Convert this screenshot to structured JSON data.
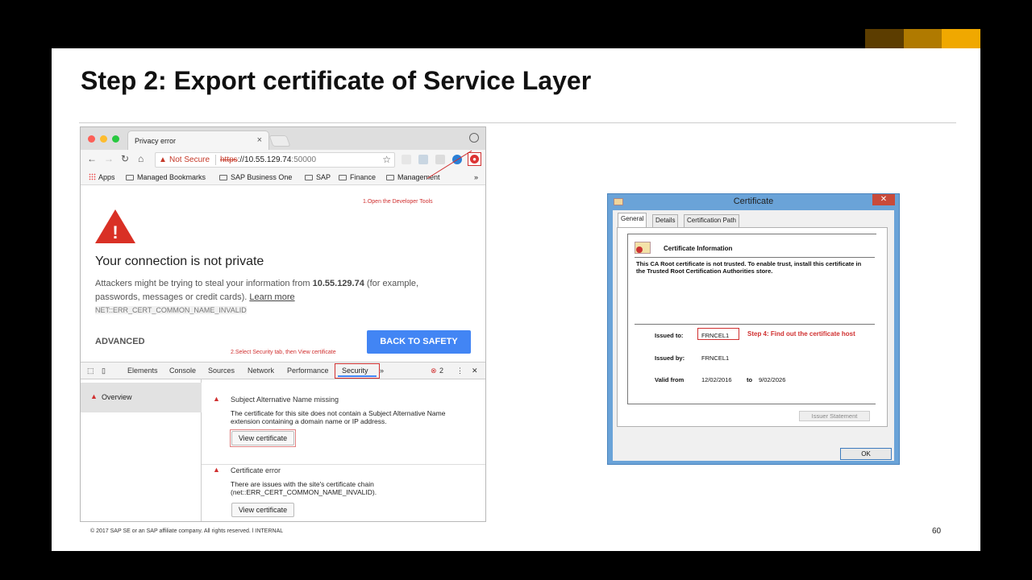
{
  "slide": {
    "title": "Step 2: Export certificate of Service Layer",
    "footer": "© 2017 SAP SE or an SAP affiliate company. All rights reserved.  ǀ   INTERNAL",
    "page_number": "60",
    "brand_colors": [
      "#5c3d00",
      "#b07a00",
      "#f0a800"
    ]
  },
  "browser": {
    "tab_title": "Privacy error",
    "tab_close": "×",
    "url_not_secure": "Not Secure",
    "url_scheme": "https",
    "url_rest": "://10.55.129.74",
    "url_port": ":50000",
    "bookmarks": [
      "Apps",
      "Managed Bookmarks",
      "SAP Business One",
      "SAP",
      "Finance",
      "Management"
    ],
    "bookmarks_more": "»",
    "annotation_1": "1.Open the Developer Tools",
    "error_heading": "Your connection is not private",
    "error_body_pre": "Attackers might be trying to steal your information from ",
    "error_host": "10.55.129.74",
    "error_body_post": " (for example, passwords, messages or credit cards). ",
    "learn_more": "Learn more",
    "error_code": "NET::ERR_CERT_COMMON_NAME_INVALID",
    "advanced": "ADVANCED",
    "back_to_safety": "BACK TO SAFETY",
    "annotation_2": "2.Select Security tab, then View certificate"
  },
  "devtools": {
    "tabs": [
      "Elements",
      "Console",
      "Sources",
      "Network",
      "Performance",
      "Security"
    ],
    "more": "»",
    "error_count": "2",
    "sidebar_overview": "Overview",
    "issues": [
      {
        "title": "Subject Alternative Name missing",
        "description": "The certificate for this site does not contain a Subject Alternative Name extension containing a domain name or IP address.",
        "button": "View certificate"
      },
      {
        "title": "Certificate error",
        "description": "There are issues with the site's certificate chain (net::ERR_CERT_COMMON_NAME_INVALID).",
        "button": "View certificate"
      }
    ]
  },
  "certificate": {
    "window_title": "Certificate",
    "close": "✕",
    "tabs": [
      "General",
      "Details",
      "Certification Path"
    ],
    "info_title": "Certificate Information",
    "warning": "This CA Root certificate is not trusted. To enable trust, install this certificate in the Trusted Root Certification Authorities store.",
    "issued_to_label": "Issued to:",
    "issued_to": "FRNCEL1",
    "issued_by_label": "Issued by:",
    "issued_by": "FRNCEL1",
    "valid_from_label": "Valid from",
    "valid_from": "12/02/2016",
    "valid_to_word": "to",
    "valid_to": "9/02/2026",
    "step4": "Step 4: Find out the certificate host",
    "issuer_statement": "Issuer Statement",
    "ok": "OK"
  }
}
